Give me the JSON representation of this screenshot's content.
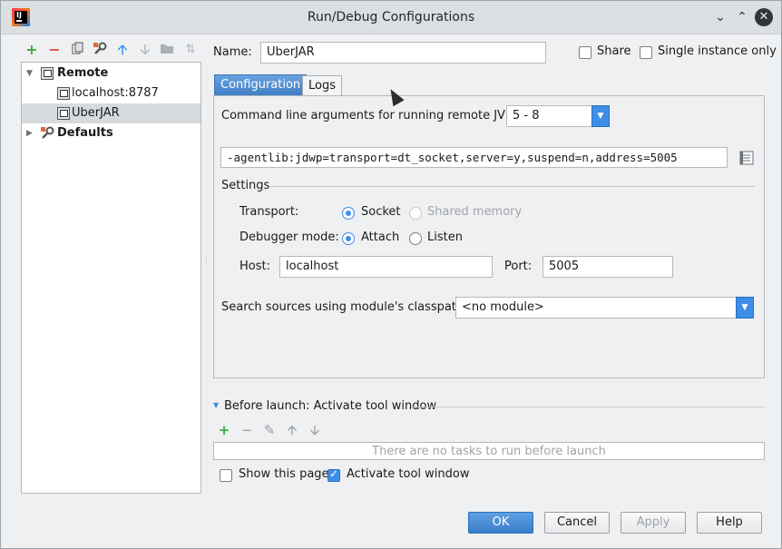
{
  "window": {
    "title": "Run/Debug Configurations"
  },
  "toolbar": {
    "add": "+",
    "remove": "−",
    "sort": "⇅"
  },
  "tree": {
    "remote_label": "Remote",
    "items": [
      {
        "label": "localhost:8787"
      },
      {
        "label": "UberJAR"
      }
    ],
    "defaults_label": "Defaults"
  },
  "name_field": {
    "label": "Name:",
    "value": "UberJAR"
  },
  "share": {
    "label": "Share",
    "checked": false
  },
  "single_instance": {
    "label": "Single instance only",
    "checked": false
  },
  "tabs": [
    {
      "label": "Configuration",
      "active": true
    },
    {
      "label": "Logs",
      "active": false
    }
  ],
  "config": {
    "cmdline_label": "Command line arguments for running remote JVM",
    "jvm_select": "5 - 8",
    "args_value": "-agentlib:jdwp=transport=dt_socket,server=y,suspend=n,address=5005",
    "settings_label": "Settings",
    "transport_label": "Transport:",
    "transport_options": [
      "Socket",
      "Shared memory"
    ],
    "debugger_mode_label": "Debugger mode:",
    "debugger_mode_options": [
      "Attach",
      "Listen"
    ],
    "host_label": "Host:",
    "host_value": "localhost",
    "port_label": "Port:",
    "port_value": "5005",
    "module_label": "Search sources using module's classpath:",
    "module_select": "<no module>"
  },
  "before_launch": {
    "title": "Before launch: Activate tool window",
    "empty_text": "There are no tasks to run before launch",
    "show_page_label": "Show this page",
    "show_page_checked": false,
    "activate_label": "Activate tool window",
    "activate_checked": true
  },
  "buttons": {
    "ok": "OK",
    "cancel": "Cancel",
    "apply": "Apply",
    "help": "Help"
  },
  "colors": {
    "accent": "#3d8ee8",
    "add_green": "#3aa845",
    "remove_red": "#d9534f"
  }
}
